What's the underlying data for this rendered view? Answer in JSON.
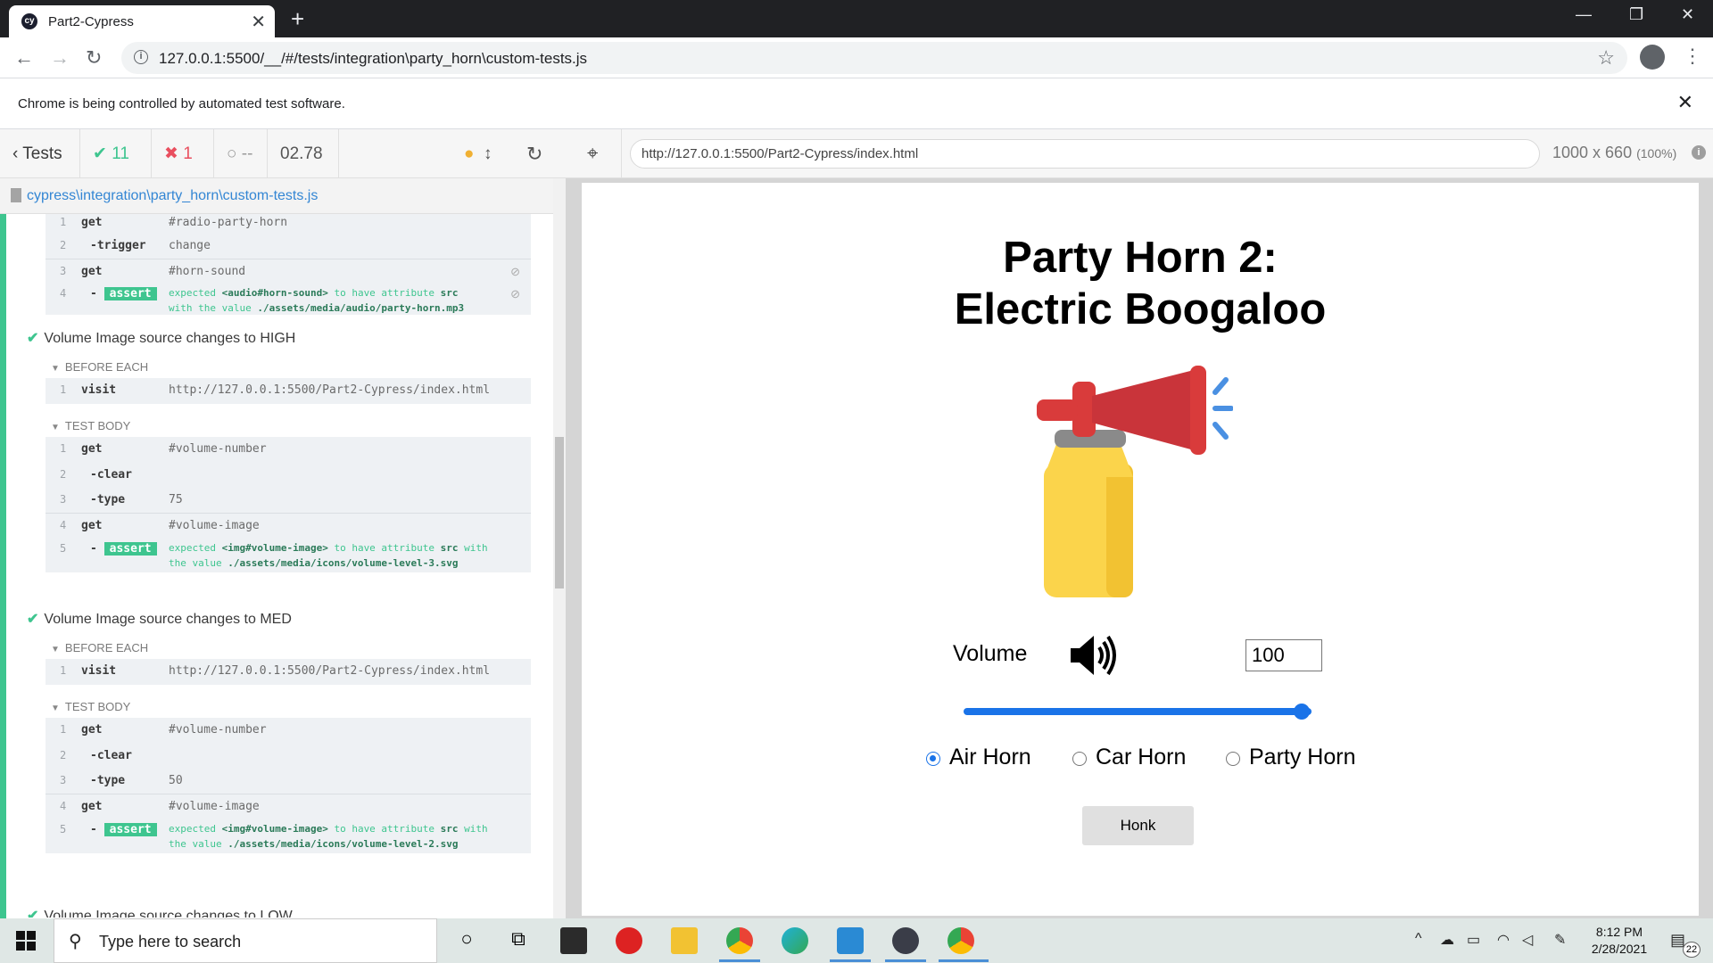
{
  "browser": {
    "tab_title": "Part2-Cypress",
    "tab_favicon": "cy",
    "url": "127.0.0.1:5500/__/#/tests/integration\\party_horn\\custom-tests.js",
    "infobar_message": "Chrome is being controlled by automated test software."
  },
  "reporter": {
    "tests_label": "Tests",
    "passed": "11",
    "failed": "1",
    "pending": "--",
    "duration": "02.78",
    "spec_path": "cypress\\integration\\party_horn\\custom-tests.js",
    "partial_block": [
      {
        "num": "1",
        "name": "get",
        "value": "#radio-party-horn"
      },
      {
        "num": "2",
        "name": "-trigger",
        "value": "change"
      },
      {
        "num": "3",
        "name": "get",
        "value": "#horn-sound"
      },
      {
        "num": "4",
        "name": "-",
        "badge": "assert",
        "msg_pre": "expected ",
        "msg_el": "<audio#horn-sound>",
        "msg_mid": " to have attribute ",
        "msg_attr": "src",
        "msg_line2_pre": "with the value ",
        "msg_val": "./assets/media/audio/party-horn.mp3"
      }
    ],
    "tests": [
      {
        "title": "Volume Image source changes to HIGH",
        "before_each_label": "BEFORE EACH",
        "visit": {
          "num": "1",
          "name": "visit",
          "value": "http://127.0.0.1:5500/Part2-Cypress/index.html"
        },
        "body_label": "TEST BODY",
        "cmds": [
          {
            "num": "1",
            "name": "get",
            "value": "#volume-number"
          },
          {
            "num": "2",
            "name": "-clear",
            "value": ""
          },
          {
            "num": "3",
            "name": "-type",
            "value": "75"
          },
          {
            "num": "4",
            "name": "get",
            "value": "#volume-image"
          }
        ],
        "assert": {
          "num": "5",
          "dash": "-",
          "badge": "assert",
          "pre": "expected ",
          "el": "<img#volume-image>",
          "mid": " to have attribute ",
          "attr": "src",
          "post": " with",
          "line2": "the value ",
          "val": "./assets/media/icons/volume-level-3.svg"
        }
      },
      {
        "title": "Volume Image source changes to MED",
        "before_each_label": "BEFORE EACH",
        "visit": {
          "num": "1",
          "name": "visit",
          "value": "http://127.0.0.1:5500/Part2-Cypress/index.html"
        },
        "body_label": "TEST BODY",
        "cmds": [
          {
            "num": "1",
            "name": "get",
            "value": "#volume-number"
          },
          {
            "num": "2",
            "name": "-clear",
            "value": ""
          },
          {
            "num": "3",
            "name": "-type",
            "value": "50"
          },
          {
            "num": "4",
            "name": "get",
            "value": "#volume-image"
          }
        ],
        "assert": {
          "num": "5",
          "dash": "-",
          "badge": "assert",
          "pre": "expected ",
          "el": "<img#volume-image>",
          "mid": " to have attribute ",
          "attr": "src",
          "post": " with",
          "line2": "the value ",
          "val": "./assets/media/icons/volume-level-2.svg"
        }
      }
    ],
    "partial_next_title": "Volume Image source changes to LOW"
  },
  "runner": {
    "aut_url": "http://127.0.0.1:5500/Part2-Cypress/index.html",
    "dims": "1000 x 660",
    "zoom": "(100%)"
  },
  "app": {
    "title_line1": "Party Horn 2:",
    "title_line2": "Electric Boogaloo",
    "volume_label": "Volume",
    "volume_value": "100",
    "slider_fraction": 1.0,
    "radios": [
      {
        "label": "Air Horn",
        "checked": true
      },
      {
        "label": "Car Horn",
        "checked": false
      },
      {
        "label": "Party Horn",
        "checked": false
      }
    ],
    "honk_label": "Honk"
  },
  "taskbar": {
    "search_placeholder": "Type here to search",
    "time": "8:12 PM",
    "date": "2/28/2021",
    "notifications": "22"
  },
  "colors": {
    "pass_green": "#3ec58f",
    "fail_red": "#e94f5f",
    "link_blue": "#3386d4",
    "accent_blue": "#1a73e8"
  }
}
